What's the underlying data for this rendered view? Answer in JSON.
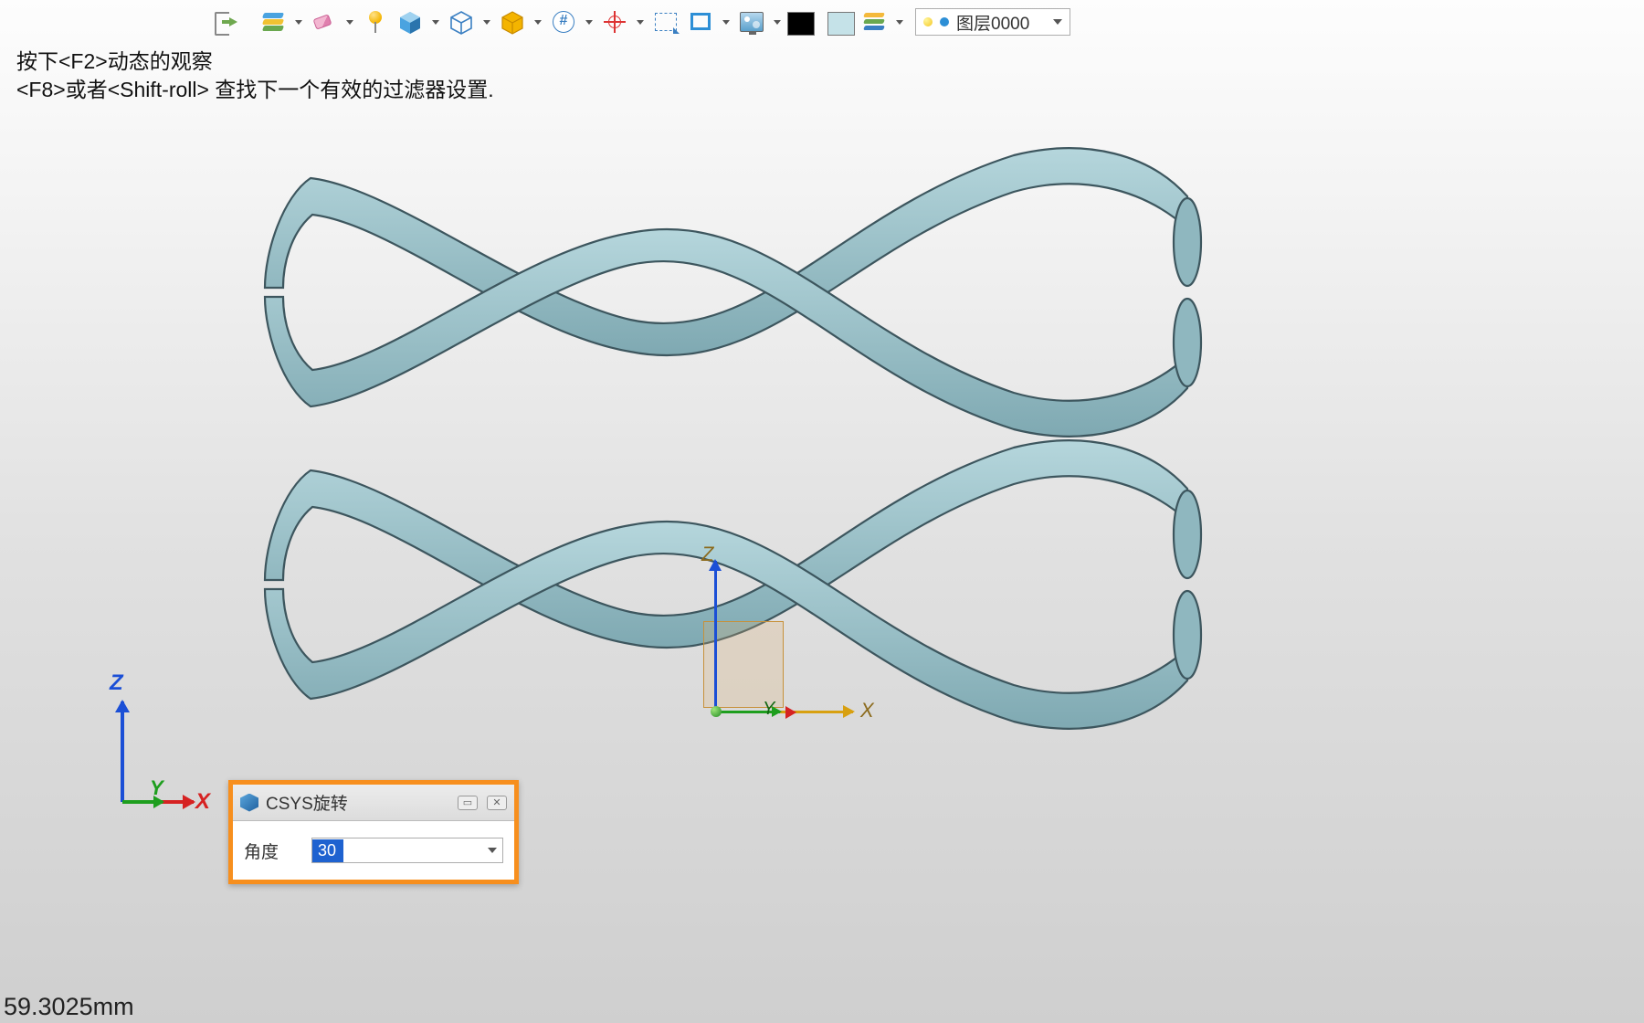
{
  "toolbar": {
    "buttons": [
      {
        "name": "exit-icon",
        "tip": "退出"
      },
      {
        "name": "layers-icon",
        "tip": "图层",
        "dd": true
      },
      {
        "name": "eraser-icon",
        "tip": "橡皮",
        "dd": true
      },
      {
        "name": "pin-icon",
        "tip": "固定"
      },
      {
        "name": "cube-shaded-icon",
        "tip": "着色",
        "dd": true
      },
      {
        "name": "cube-wire-icon",
        "tip": "线框",
        "dd": true
      },
      {
        "name": "hexagon-icon",
        "tip": "等轴",
        "dd": true
      },
      {
        "name": "hash-target-icon",
        "tip": "标记",
        "dd": true
      },
      {
        "name": "crosshair-icon",
        "tip": "中心",
        "dd": true
      },
      {
        "name": "fit-icon",
        "tip": "适配"
      },
      {
        "name": "measure-icon",
        "tip": "测量",
        "dd": true
      },
      {
        "name": "render-icon",
        "tip": "渲染",
        "dd": true
      },
      {
        "name": "swatch-black",
        "tip": "前景色"
      },
      {
        "name": "swatch-pale",
        "tip": "背景色"
      },
      {
        "name": "stack-icon",
        "tip": "图层集",
        "dd": true
      }
    ],
    "layer_field": {
      "value": "图层0000"
    }
  },
  "hints": {
    "line1": "按下<F2>动态的观察",
    "line2": "<F8>或者<Shift-roll> 查找下一个有效的过滤器设置."
  },
  "status": {
    "value": "59.3025mm"
  },
  "axis": {
    "x": "X",
    "y": "Y",
    "z": "Z"
  },
  "dialog": {
    "title": "CSYS旋转",
    "field_label": "角度",
    "field_value": "30"
  },
  "colors": {
    "ribbon_fill": "#9fc7cf",
    "ribbon_edge": "#39525a",
    "axis_x": "#d62222",
    "axis_y": "#1e9e1e",
    "axis_z": "#1b4fd6",
    "highlight": "#f78f1e"
  }
}
